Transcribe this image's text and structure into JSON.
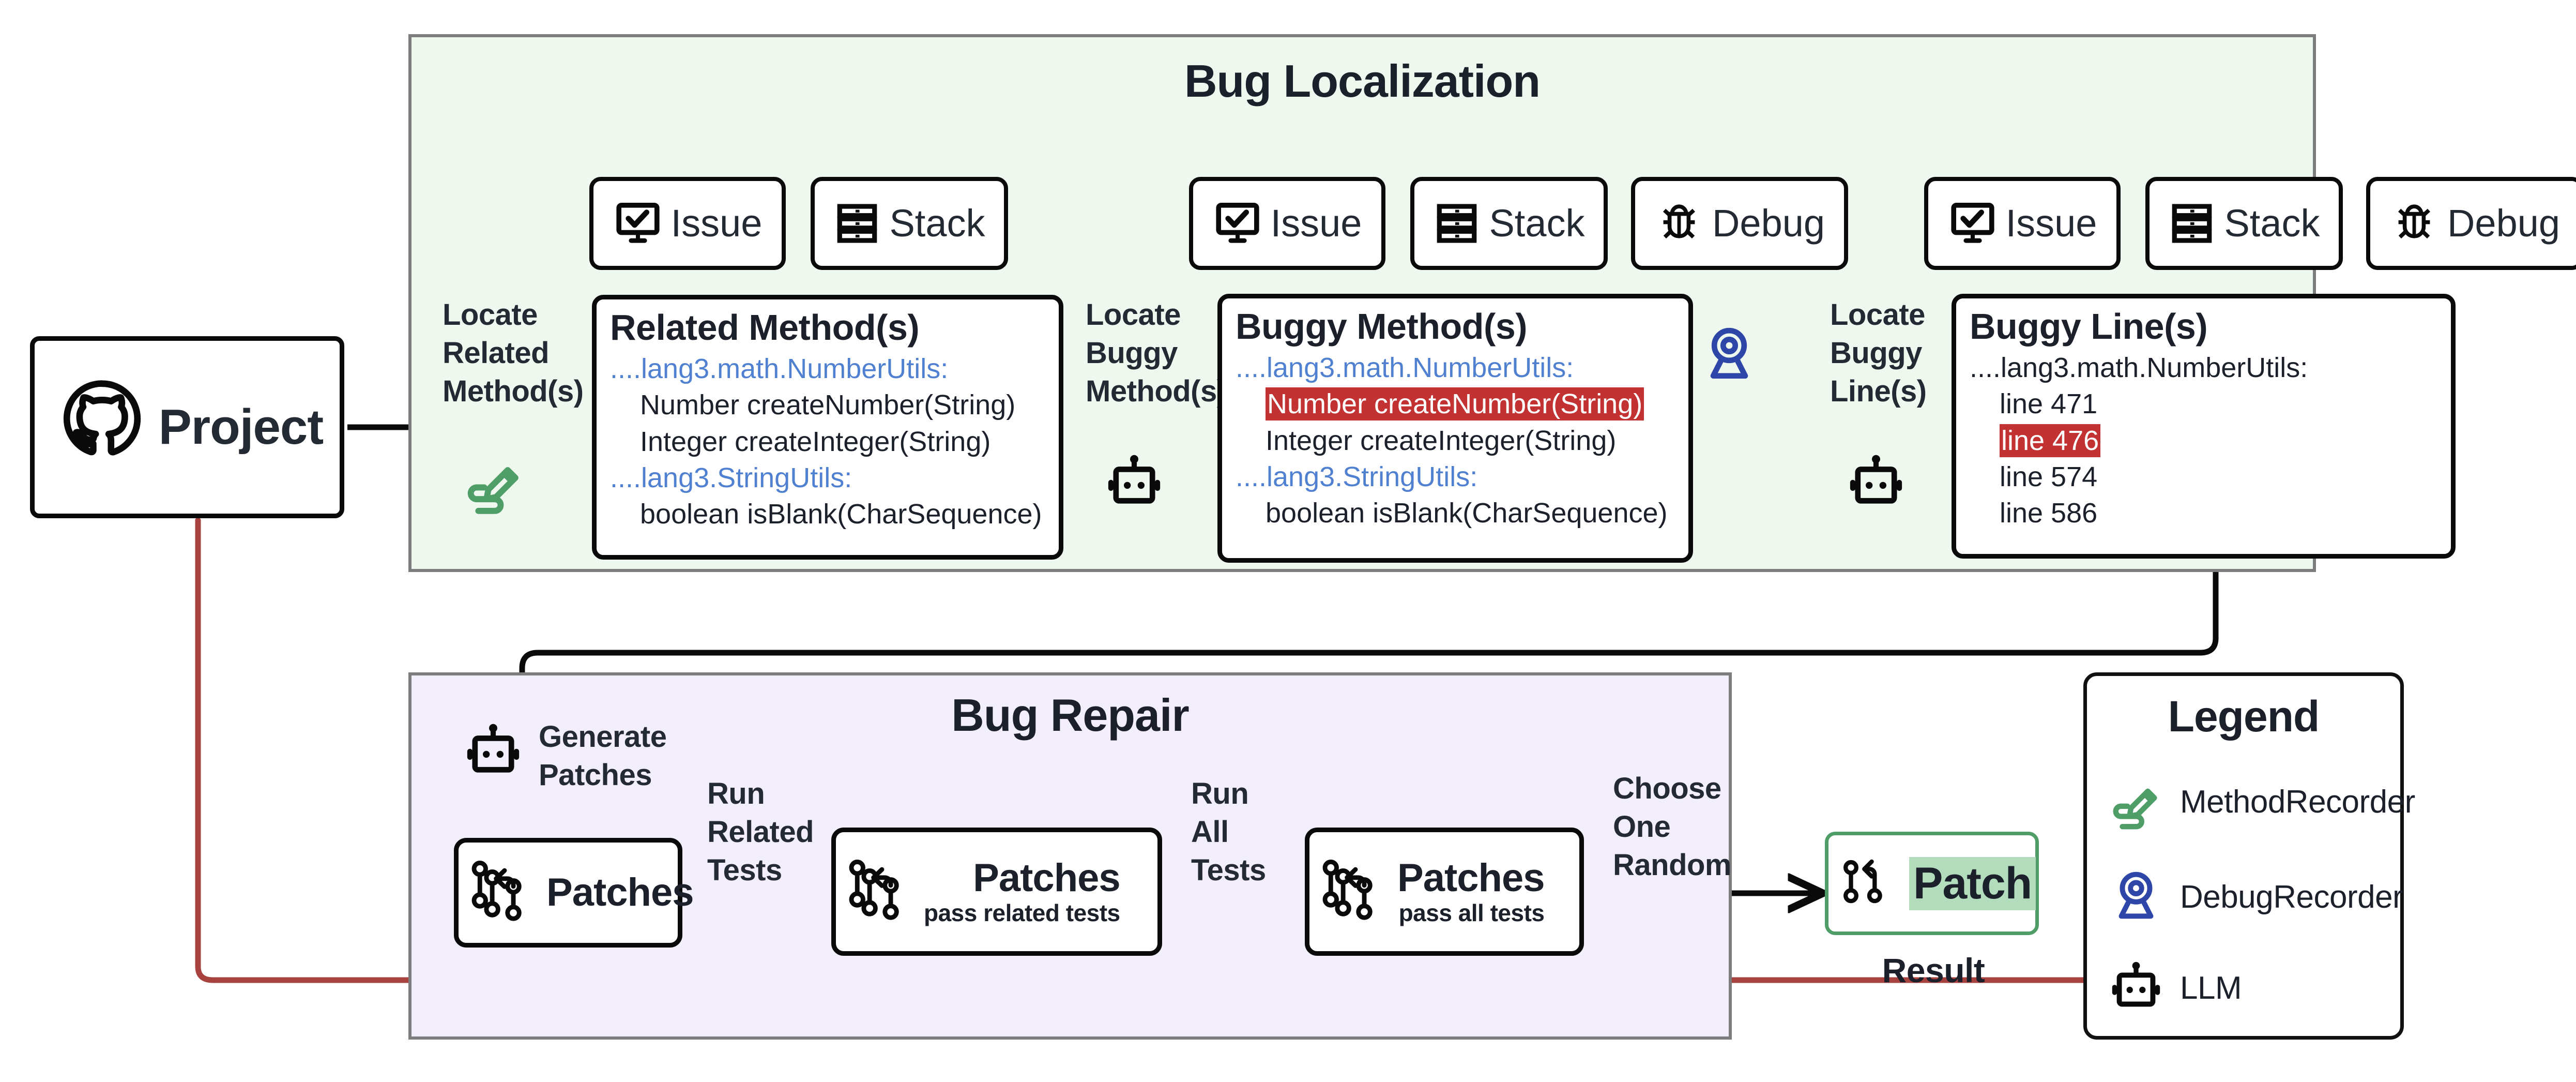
{
  "localization": {
    "title": "Bug Localization",
    "chips_group_1": [
      {
        "icon": "issue-monitor-icon",
        "label": "Issue"
      },
      {
        "icon": "stack-server-icon",
        "label": "Stack"
      }
    ],
    "chips_group_2": [
      {
        "icon": "issue-monitor-icon",
        "label": "Issue"
      },
      {
        "icon": "stack-server-icon",
        "label": "Stack"
      },
      {
        "icon": "debug-bug-icon",
        "label": "Debug"
      }
    ],
    "chips_group_3": [
      {
        "icon": "issue-monitor-icon",
        "label": "Issue"
      },
      {
        "icon": "stack-server-icon",
        "label": "Stack"
      },
      {
        "icon": "debug-bug-icon",
        "label": "Debug"
      }
    ],
    "edges": [
      {
        "label": "Locate\nRelated\nMethod(s)",
        "actor_icon": "method-recorder-icon"
      },
      {
        "label": "Locate\nBuggy\nMethod(s)",
        "actor_icon": "llm-robot-icon"
      },
      {
        "label": "Locate\nBuggy\nLine(s)",
        "actor_icon": "llm-robot-icon"
      }
    ],
    "debug_recorder_icon": "debug-recorder-icon",
    "related_methods": {
      "title": "Related Method(s)",
      "entries": [
        {
          "package": "....lang3.math.NumberUtils:",
          "package_color": "blue",
          "methods": [
            {
              "text": "Number createNumber(String)",
              "highlight": false
            },
            {
              "text": "Integer createInteger(String)",
              "highlight": false
            }
          ]
        },
        {
          "package": "....lang3.StringUtils:",
          "package_color": "blue",
          "methods": [
            {
              "text": "boolean isBlank(CharSequence)",
              "highlight": false
            }
          ]
        }
      ]
    },
    "buggy_methods": {
      "title": "Buggy Method(s)",
      "entries": [
        {
          "package": "....lang3.math.NumberUtils:",
          "package_color": "blue",
          "methods": [
            {
              "text": "Number createNumber(String)",
              "highlight": true
            },
            {
              "text": "Integer createInteger(String)",
              "highlight": false
            }
          ]
        },
        {
          "package": "....lang3.StringUtils:",
          "package_color": "blue",
          "methods": [
            {
              "text": "boolean isBlank(CharSequence)",
              "highlight": false
            }
          ]
        }
      ]
    },
    "buggy_lines": {
      "title": "Buggy Line(s)",
      "entries": [
        {
          "package": "....lang3.math.NumberUtils:",
          "package_color": "black",
          "methods": [
            {
              "text": "line 471",
              "highlight": false
            },
            {
              "text": "line 476",
              "highlight": true
            },
            {
              "text": "line 574",
              "highlight": false
            },
            {
              "text": "line 586",
              "highlight": false
            }
          ]
        }
      ]
    }
  },
  "project": {
    "label": "Project",
    "icon": "github-icon"
  },
  "repair": {
    "title": "Bug Repair",
    "generate_label": "Generate\nPatches",
    "generate_actor_icon": "llm-robot-icon",
    "stages": [
      {
        "icon": "git-branch-icon",
        "main": "Patches",
        "sub": ""
      },
      {
        "icon": "git-branch-icon",
        "main": "Patches",
        "sub": "pass related tests"
      },
      {
        "icon": "git-branch-icon",
        "main": "Patches",
        "sub": "pass all tests"
      }
    ],
    "edges": [
      {
        "label": "Run\nRelated\nTests"
      },
      {
        "label": "Run\nAll\nTests"
      },
      {
        "label": "Choose\nOne\nRandom"
      }
    ]
  },
  "result": {
    "icon": "git-branch-icon",
    "label": "Patch",
    "caption": "Result"
  },
  "legend": {
    "title": "Legend",
    "items": [
      {
        "icon": "method-recorder-icon",
        "label": "MethodRecorder"
      },
      {
        "icon": "debug-recorder-icon",
        "label": "DebugRecorder"
      },
      {
        "icon": "llm-robot-icon",
        "label": "LLM"
      }
    ]
  },
  "colors": {
    "localization_panel_bg": "#eef8ef",
    "repair_panel_bg": "#f3eefb",
    "panel_border": "#7d7d7d",
    "package_blue": "#5080d0",
    "highlight_red": "#c33232",
    "method_recorder_green": "#4f9e68",
    "debug_recorder_blue": "#2e46a8",
    "result_green_border": "#4f9e68",
    "result_green_fill": "#b2dcbc",
    "feedback_arrow_red": "#a8423f",
    "ink": "#1b202a"
  }
}
